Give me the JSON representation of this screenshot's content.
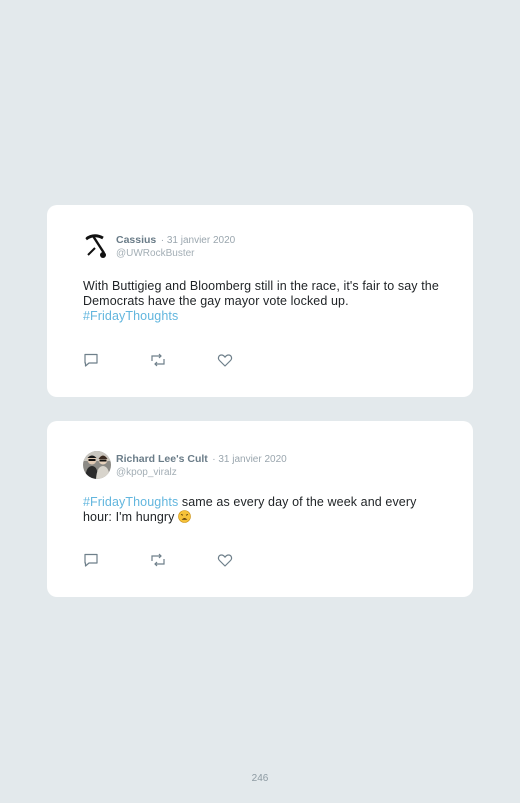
{
  "tweets": [
    {
      "author_name": "Cassius",
      "date": "· 31 janvier 2020",
      "handle": "@UWRockBuster",
      "text_parts": [
        {
          "text": "With Buttigieg and Bloomberg still in the race, it's fair to say the Democrats have the gay mayor vote locked up. ",
          "hashtag": false
        },
        {
          "text": "#FridayThoughts",
          "hashtag": true
        }
      ],
      "avatar_icon": "pickaxe-icon"
    },
    {
      "author_name": "Richard Lee's Cult",
      "date": "· 31 janvier 2020",
      "handle": "@kpop_viralz",
      "text_parts": [
        {
          "text": "#FridayThoughts",
          "hashtag": true
        },
        {
          "text": " same as every day of the week and every hour: I'm hungry ",
          "hashtag": false
        }
      ],
      "emoji_icon": "weary-face-icon",
      "avatar_icon": "group-photo-icon"
    }
  ],
  "actions": [
    "reply-icon",
    "retweet-icon",
    "like-icon"
  ],
  "colors": {
    "background": "#e3e9ec",
    "hashtag": "#62b6de",
    "name": "#6a7c88"
  },
  "page_number": "246"
}
